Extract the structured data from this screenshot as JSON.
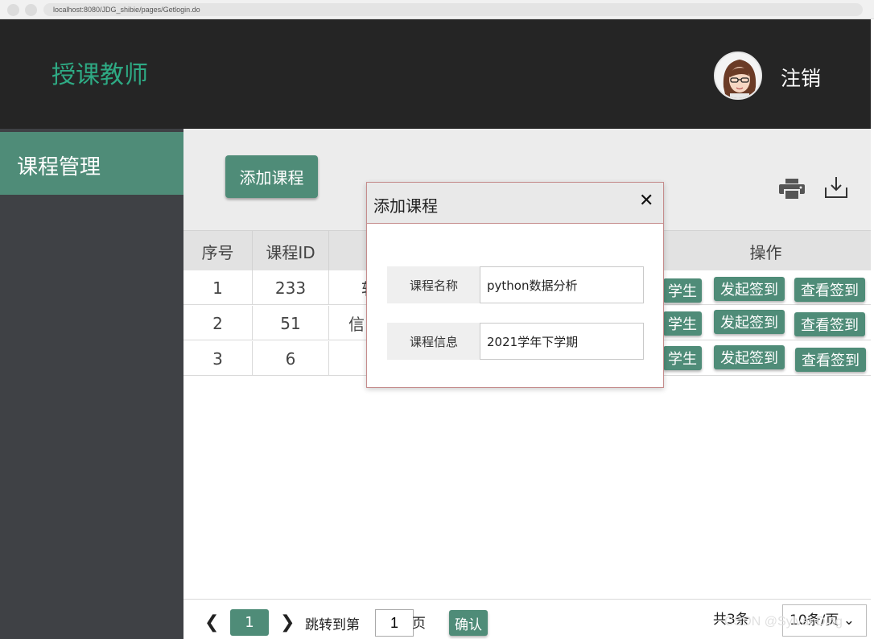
{
  "browser": {
    "url": "localhost:8080/JDG_shibie/pages/Getlogin.do"
  },
  "header": {
    "title": "授课教师",
    "logout_label": "注销"
  },
  "sidebar": {
    "items": [
      {
        "label": "课程管理"
      }
    ]
  },
  "toolbar": {
    "add_label": "添加课程"
  },
  "table": {
    "headers": [
      "序号",
      "课程ID",
      "",
      "操作"
    ],
    "rows": [
      {
        "index": "1",
        "course_id": "233",
        "name_partial": "软"
      },
      {
        "index": "2",
        "course_id": "51",
        "name_partial": "信"
      },
      {
        "index": "3",
        "course_id": "6",
        "name_partial": ""
      }
    ],
    "actions": {
      "students_partial": "学生",
      "start_signin": "发起签到",
      "view_signin": "查看签到"
    }
  },
  "modal": {
    "title": "添加课程",
    "close": "✕",
    "name_label": "课程名称",
    "name_value": "python数据分析",
    "info_label": "课程信息",
    "info_value": "2021学年下学期"
  },
  "pagination": {
    "prev": "❮",
    "current": "1",
    "next": "❯",
    "jump_label": "跳转到第",
    "jump_value": "1",
    "page_unit": "页",
    "confirm": "确认",
    "total": "共3条",
    "page_size": "10条/页 ⌄"
  },
  "watermark": "CSDN @SylvanDing",
  "colors": {
    "accent": "#4f8c78",
    "brand_text": "#2eaa84",
    "header_bg": "#252525",
    "sidebar_bg": "#3f4145"
  }
}
